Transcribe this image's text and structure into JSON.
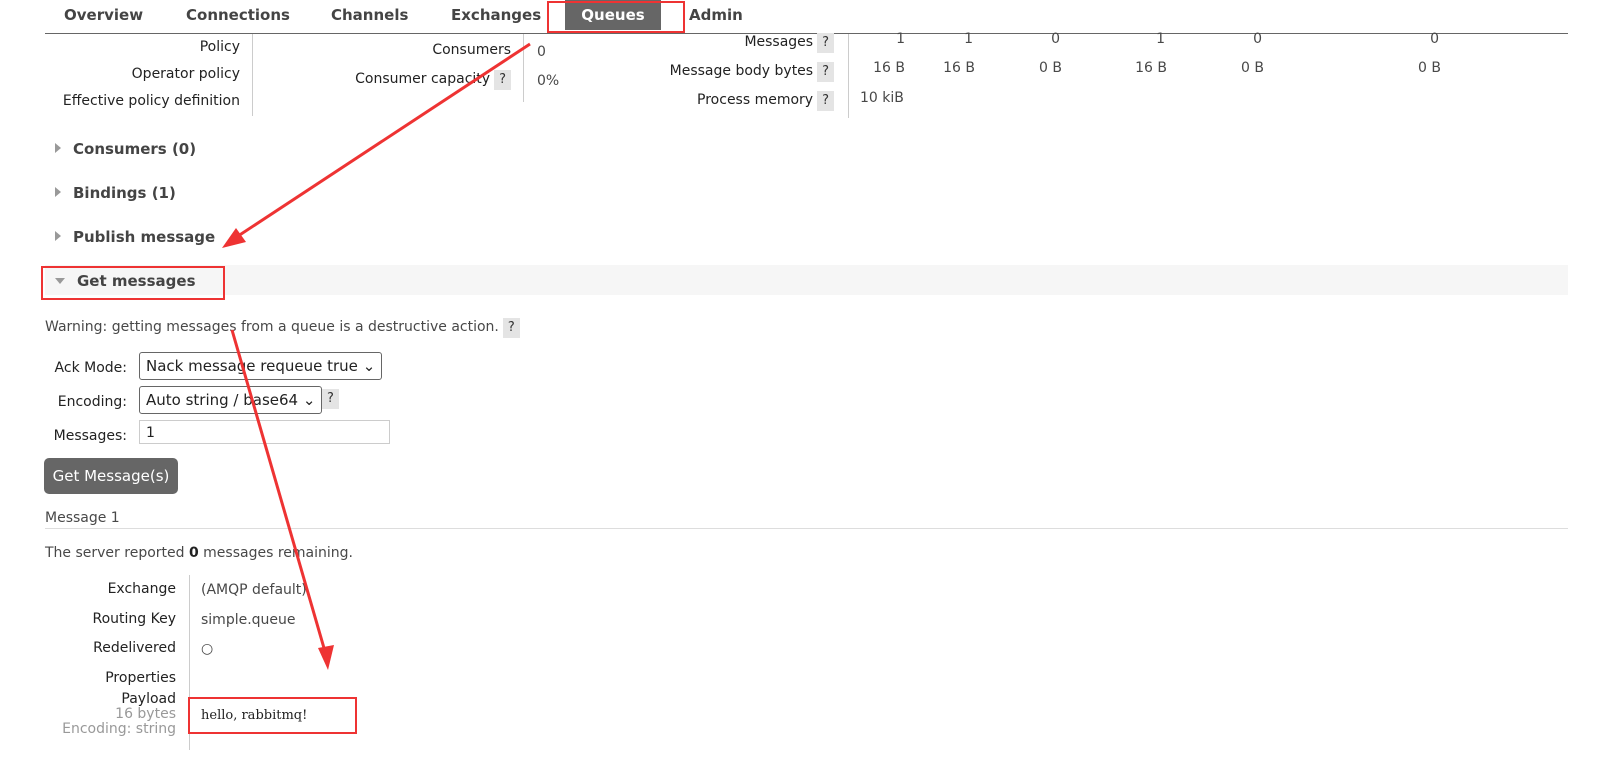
{
  "nav": {
    "tabs": [
      "Overview",
      "Connections",
      "Channels",
      "Exchanges",
      "Queues",
      "Admin"
    ],
    "active": "Queues"
  },
  "details": {
    "policy_labels": [
      "Policy",
      "Operator policy",
      "Effective policy definition"
    ],
    "consumers_label": "Consumers",
    "consumers_value": "0",
    "capacity_label": "Consumer capacity",
    "capacity_value": "0%",
    "help": "?",
    "messages_label": "Messages",
    "messages_values": [
      "1",
      "1",
      "0",
      "1",
      "0",
      "0"
    ],
    "bytes_label": "Message body bytes",
    "bytes_values": [
      "16 B",
      "16 B",
      "0 B",
      "16 B",
      "0 B",
      "0 B"
    ],
    "memory_label": "Process memory",
    "memory_value": "10 kiB"
  },
  "sections": {
    "consumers": "Consumers (0)",
    "bindings": "Bindings (1)",
    "publish": "Publish message",
    "get": "Get messages"
  },
  "get": {
    "warning": "Warning: getting messages from a queue is a destructive action.",
    "ack_label": "Ack Mode:",
    "ack_value": "Nack message requeue true",
    "encoding_label": "Encoding:",
    "encoding_value": "Auto string / base64",
    "messages_label": "Messages:",
    "messages_value": "1",
    "button": "Get Message(s)"
  },
  "result": {
    "title": "Message 1",
    "reported_pre": "The server reported ",
    "reported_count": "0",
    "reported_post": " messages remaining.",
    "exchange_label": "Exchange",
    "exchange_value": "(AMQP default)",
    "routing_label": "Routing Key",
    "routing_value": "simple.queue",
    "redelivered_label": "Redelivered",
    "redelivered_value": "○",
    "properties_label": "Properties",
    "payload_label": "Payload",
    "payload_size": "16 bytes",
    "payload_encoding": "Encoding: string",
    "payload_value": "hello, rabbitmq!"
  },
  "annotation_color": "#ee3333"
}
